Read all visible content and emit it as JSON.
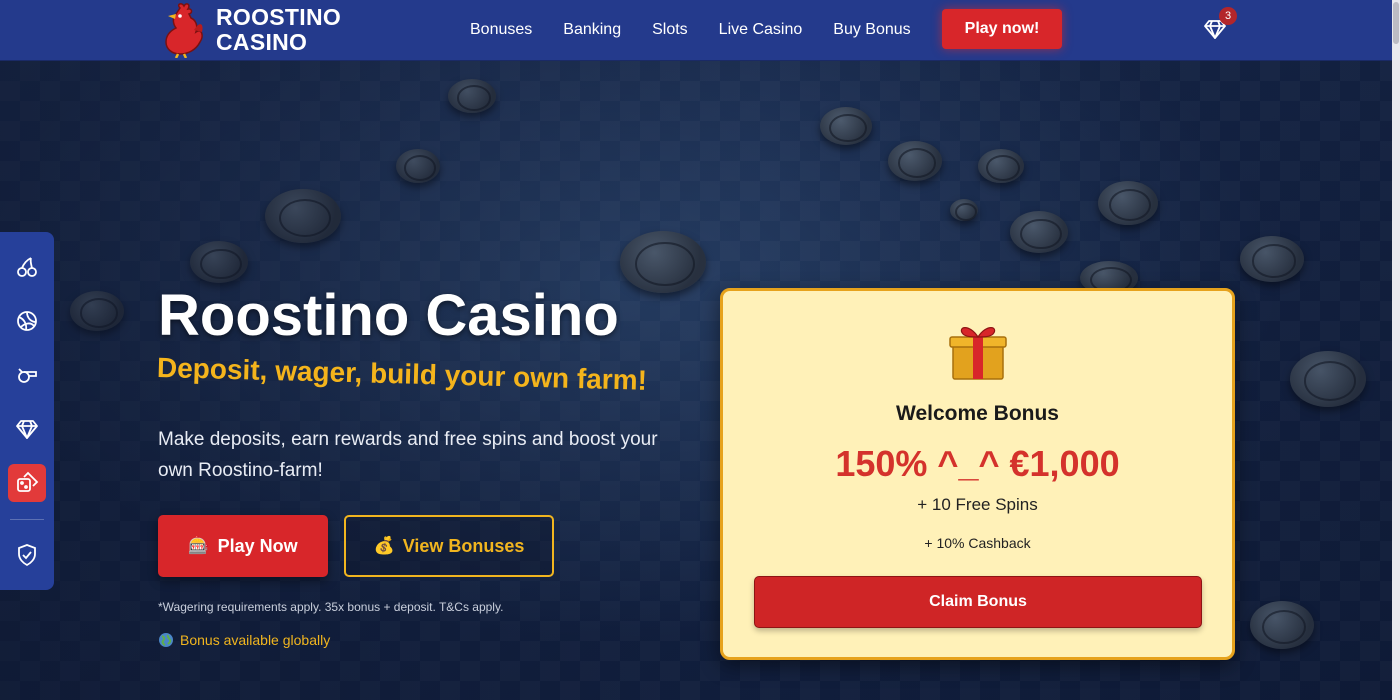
{
  "header": {
    "logo_line1": "ROOSTINO",
    "logo_line2": "CASINO",
    "nav": [
      "Bonuses",
      "Banking",
      "Slots",
      "Live Casino",
      "Buy Bonus"
    ],
    "cta": "Play now!",
    "gem_count": "3"
  },
  "sidebar": {
    "items": [
      {
        "icon": "cherry-icon"
      },
      {
        "icon": "volleyball-icon"
      },
      {
        "icon": "whistle-icon"
      },
      {
        "icon": "diamond-icon"
      },
      {
        "icon": "dice-icon",
        "active": true
      },
      {
        "icon": "shield-check-icon"
      }
    ]
  },
  "hero": {
    "title": "Roostino Casino",
    "subtitle": "Deposit, wager, build your own farm!",
    "description": "Make deposits, earn rewards and free spins and boost your own Roostino-farm!",
    "play_label": "Play Now",
    "play_emoji": "🎰",
    "bonuses_label": "View Bonuses",
    "bonuses_emoji": "💰",
    "terms": "*Wagering requirements apply. 35x bonus + deposit. T&Cs apply.",
    "global_note": "Bonus available globally"
  },
  "bonus_card": {
    "title": "Welcome Bonus",
    "offer": "150% ^_^ €1,000",
    "spins": "+ 10 Free Spins",
    "cashback": "+ 10% Cashback",
    "claim_label": "Claim Bonus"
  },
  "colors": {
    "header_bg": "#243a8c",
    "brand_red": "#d8262a",
    "gold": "#f1b51f",
    "card_bg": "#fff1b8"
  }
}
